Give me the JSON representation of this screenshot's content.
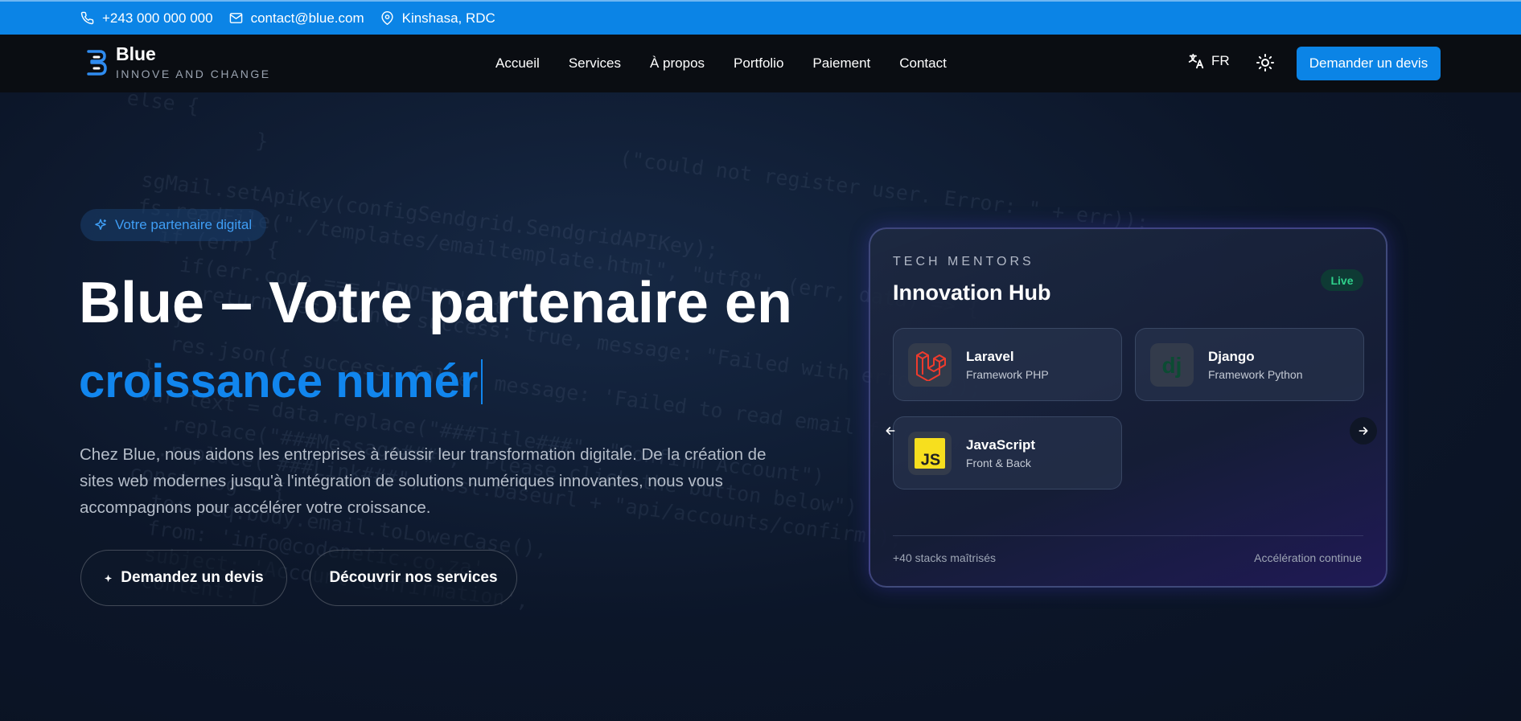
{
  "topbar": {
    "phone": "+243 000 000 000",
    "email": "contact@blue.com",
    "location": "Kinshasa, RDC",
    "icons": [
      "phone-icon",
      "mail-icon",
      "map-pin-icon"
    ]
  },
  "brand": {
    "name": "Blue",
    "tagline": "INNOVE AND CHANGE"
  },
  "nav": {
    "items": [
      {
        "label": "Accueil"
      },
      {
        "label": "Services"
      },
      {
        "label": "À propos"
      },
      {
        "label": "Portfolio"
      },
      {
        "label": "Paiement"
      },
      {
        "label": "Contact"
      }
    ],
    "language": "FR",
    "cta_label": "Demander un devis"
  },
  "hero": {
    "badge": "Votre partenaire digital",
    "title_line1": "Blue – Votre partenaire en",
    "title_typed": "croissance numér",
    "description": "Chez Blue, nous aidons les entreprises à réussir leur transformation digitale. De la création de sites web modernes jusqu'à l'intégration de solutions numériques innovantes, nous vous accompagnons pour accélérer votre croissance.",
    "primary_button": "Demandez un devis",
    "secondary_button": "Découvrir nos services"
  },
  "card": {
    "kicker": "TECH MENTORS",
    "title": "Innovation Hub",
    "status": "Live",
    "tiles": [
      {
        "name": "Laravel",
        "desc": "Framework PHP",
        "icon": "laravel-icon"
      },
      {
        "name": "Django",
        "desc": "Framework Python",
        "icon": "django-icon"
      },
      {
        "name": "JavaScript",
        "desc": "Front & Back",
        "icon": "javascript-icon"
      }
    ],
    "footer_left": "+40 stacks maîtrisés",
    "footer_right": "Accélération continue"
  },
  "colors": {
    "accent": "#0b84e6",
    "headline_accent": "#1186ee",
    "live_green": "#2fd18b",
    "laravel_red": "#ef3b2d",
    "django_green": "#0c4b33",
    "js_yellow": "#f7df1e"
  }
}
